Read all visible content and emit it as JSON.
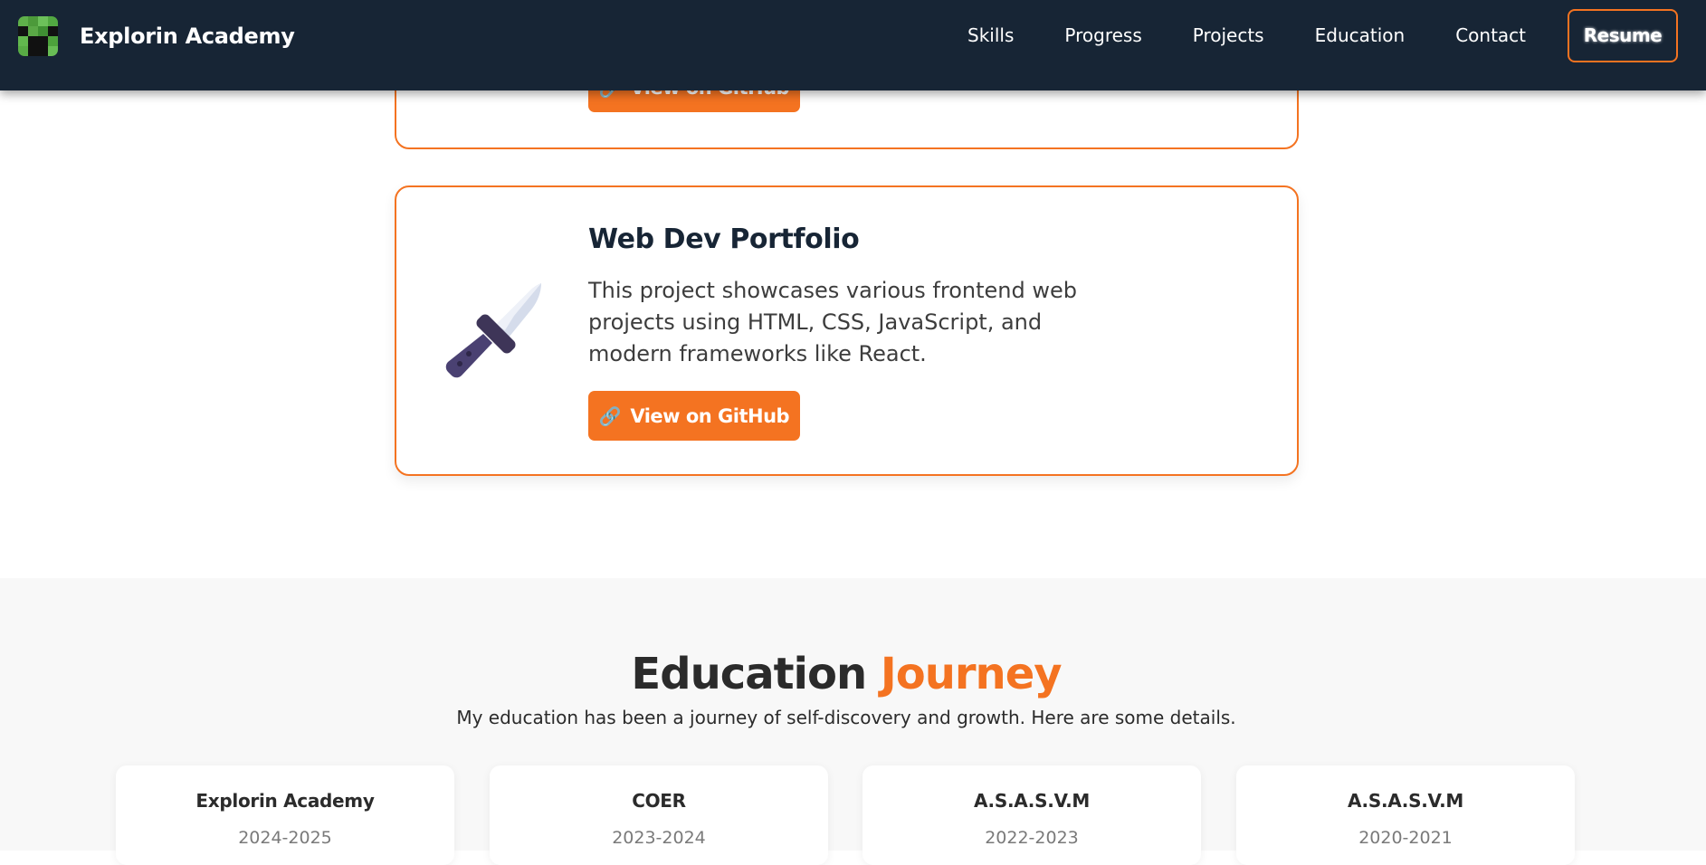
{
  "header": {
    "brand": "Explorin Academy",
    "nav": [
      "Skills",
      "Progress",
      "Projects",
      "Education",
      "Contact"
    ],
    "resume": "Resume"
  },
  "projects": [
    {
      "title": "",
      "description": "",
      "button": "View on GitHub",
      "icon": "link-icon"
    },
    {
      "title": "Web Dev Portfolio",
      "description": "This project showcases various frontend web projects using HTML, CSS, JavaScript, and modern frameworks like React.",
      "button": "View on GitHub",
      "icon": "link-icon",
      "image": "sword-icon"
    }
  ],
  "education": {
    "title_main": "Education",
    "title_accent": "Journey",
    "subtitle": "My education has been a journey of self-discovery and growth. Here are some details.",
    "items": [
      {
        "name": "Explorin Academy",
        "years": "2024-2025"
      },
      {
        "name": "COER",
        "years": "2023-2024"
      },
      {
        "name": "A.S.A.S.V.M",
        "years": "2022-2023"
      },
      {
        "name": "A.S.A.S.V.M",
        "years": "2020-2021"
      }
    ]
  },
  "colors": {
    "accent": "#f47321",
    "navbar": "#172535",
    "section_bg": "#f8f8f8"
  }
}
